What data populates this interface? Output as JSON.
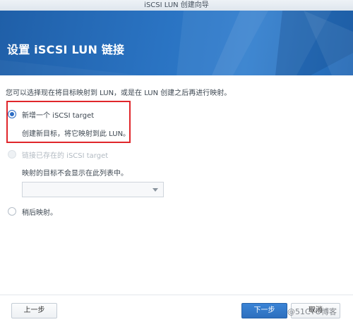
{
  "window": {
    "title": "iSCSI LUN 创建向导"
  },
  "banner": {
    "title": "设置 iSCSI LUN 链接",
    "color": "#2a73c2"
  },
  "intro_text": "您可以选择现在将目标映射到 LUN，或是在 LUN 创建之后再进行映射。",
  "options": [
    {
      "label": "新增一个 iSCSI target",
      "description": "创建新目标，将它映射到此 LUN。",
      "selected": true,
      "enabled": true
    },
    {
      "label": "链接已存在的 iSCSI target",
      "description": "映射的目标不会显示在此列表中。",
      "selected": false,
      "enabled": false
    },
    {
      "label": "稍后映射。",
      "selected": false,
      "enabled": true
    }
  ],
  "target_select": {
    "value": ""
  },
  "footer": {
    "prev_label": "上一步",
    "next_label": "下一步",
    "cancel_label": "取消"
  },
  "watermark": "@51CTO博客",
  "colors": {
    "accent": "#2b6cc4",
    "highlight_border": "#e0262b"
  }
}
